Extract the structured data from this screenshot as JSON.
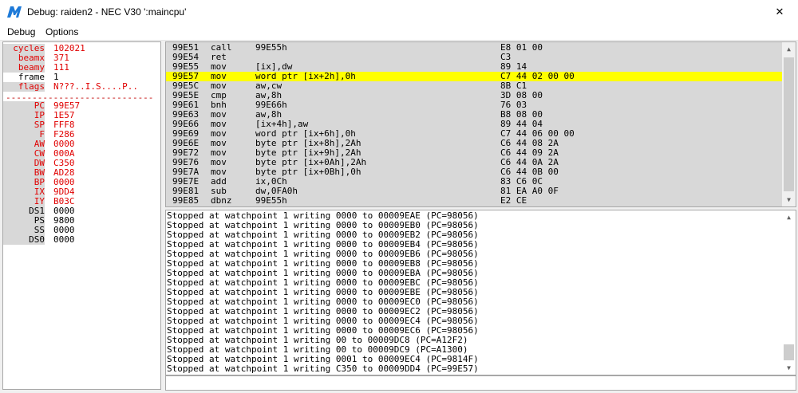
{
  "window": {
    "title": "Debug: raiden2 - NEC V30 ':maincpu'",
    "close_glyph": "✕"
  },
  "menu": [
    "Debug",
    "Options"
  ],
  "registers": {
    "header": [
      {
        "label": "cycles",
        "value": "102021"
      },
      {
        "label": "beamx",
        "value": "371"
      },
      {
        "label": "beamy",
        "value": "111"
      },
      {
        "label": "frame",
        "value": "1"
      },
      {
        "label": "flags",
        "value": "N???..I.S....P.."
      }
    ],
    "separator": "----------------------------",
    "list": [
      {
        "label": "PC",
        "value": "99E57"
      },
      {
        "label": "IP",
        "value": "1E57"
      },
      {
        "label": "SP",
        "value": "FFF8"
      },
      {
        "label": "F",
        "value": "F286"
      },
      {
        "label": "AW",
        "value": "0000"
      },
      {
        "label": "CW",
        "value": "000A"
      },
      {
        "label": "DW",
        "value": "C350"
      },
      {
        "label": "BW",
        "value": "AD28"
      },
      {
        "label": "BP",
        "value": "0000"
      },
      {
        "label": "IX",
        "value": "9DD4"
      },
      {
        "label": "IY",
        "value": "B03C"
      },
      {
        "label": "DS1",
        "value": "0000"
      },
      {
        "label": "PS",
        "value": "9800"
      },
      {
        "label": "SS",
        "value": "0000"
      },
      {
        "label": "DS0",
        "value": "0000"
      }
    ]
  },
  "disassembly": {
    "highlighted_index": 3,
    "rows": [
      {
        "addr": "99E51",
        "mnemonic": "call",
        "operands": "99E55h",
        "bytes": "E8 01 00"
      },
      {
        "addr": "99E54",
        "mnemonic": "ret",
        "operands": "",
        "bytes": "C3"
      },
      {
        "addr": "99E55",
        "mnemonic": "mov",
        "operands": "[ix],dw",
        "bytes": "89 14"
      },
      {
        "addr": "99E57",
        "mnemonic": "mov",
        "operands": "word ptr [ix+2h],0h",
        "bytes": "C7 44 02 00 00"
      },
      {
        "addr": "99E5C",
        "mnemonic": "mov",
        "operands": "aw,cw",
        "bytes": "8B C1"
      },
      {
        "addr": "99E5E",
        "mnemonic": "cmp",
        "operands": "aw,8h",
        "bytes": "3D 08 00"
      },
      {
        "addr": "99E61",
        "mnemonic": "bnh",
        "operands": "99E66h",
        "bytes": "76 03"
      },
      {
        "addr": "99E63",
        "mnemonic": "mov",
        "operands": "aw,8h",
        "bytes": "B8 08 00"
      },
      {
        "addr": "99E66",
        "mnemonic": "mov",
        "operands": "[ix+4h],aw",
        "bytes": "89 44 04"
      },
      {
        "addr": "99E69",
        "mnemonic": "mov",
        "operands": "word ptr [ix+6h],0h",
        "bytes": "C7 44 06 00 00"
      },
      {
        "addr": "99E6E",
        "mnemonic": "mov",
        "operands": "byte ptr [ix+8h],2Ah",
        "bytes": "C6 44 08 2A"
      },
      {
        "addr": "99E72",
        "mnemonic": "mov",
        "operands": "byte ptr [ix+9h],2Ah",
        "bytes": "C6 44 09 2A"
      },
      {
        "addr": "99E76",
        "mnemonic": "mov",
        "operands": "byte ptr [ix+0Ah],2Ah",
        "bytes": "C6 44 0A 2A"
      },
      {
        "addr": "99E7A",
        "mnemonic": "mov",
        "operands": "byte ptr [ix+0Bh],0h",
        "bytes": "C6 44 0B 00"
      },
      {
        "addr": "99E7E",
        "mnemonic": "add",
        "operands": "ix,0Ch",
        "bytes": "83 C6 0C"
      },
      {
        "addr": "99E81",
        "mnemonic": "sub",
        "operands": "dw,0FA0h",
        "bytes": "81 EA A0 0F"
      },
      {
        "addr": "99E85",
        "mnemonic": "dbnz",
        "operands": "99E55h",
        "bytes": "E2 CE"
      }
    ]
  },
  "console": {
    "lines": [
      "Stopped at watchpoint 1 writing 0000 to 00009EAE (PC=98056)",
      "Stopped at watchpoint 1 writing 0000 to 00009EB0 (PC=98056)",
      "Stopped at watchpoint 1 writing 0000 to 00009EB2 (PC=98056)",
      "Stopped at watchpoint 1 writing 0000 to 00009EB4 (PC=98056)",
      "Stopped at watchpoint 1 writing 0000 to 00009EB6 (PC=98056)",
      "Stopped at watchpoint 1 writing 0000 to 00009EB8 (PC=98056)",
      "Stopped at watchpoint 1 writing 0000 to 00009EBA (PC=98056)",
      "Stopped at watchpoint 1 writing 0000 to 00009EBC (PC=98056)",
      "Stopped at watchpoint 1 writing 0000 to 00009EBE (PC=98056)",
      "Stopped at watchpoint 1 writing 0000 to 00009EC0 (PC=98056)",
      "Stopped at watchpoint 1 writing 0000 to 00009EC2 (PC=98056)",
      "Stopped at watchpoint 1 writing 0000 to 00009EC4 (PC=98056)",
      "Stopped at watchpoint 1 writing 0000 to 00009EC6 (PC=98056)",
      "Stopped at watchpoint 1 writing 00 to 00009DC8 (PC=A12F2)",
      "Stopped at watchpoint 1 writing 00 to 00009DC9 (PC=A1300)",
      "Stopped at watchpoint 1 writing 0001 to 00009EC4 (PC=9814F)",
      "Stopped at watchpoint 1 writing C350 to 00009DD4 (PC=99E57)"
    ]
  },
  "command": {
    "value": ""
  },
  "colors": {
    "highlight": "#ffff00",
    "register_label": "#e00000",
    "register_value": "#e00000",
    "panel_gray": "#d8d8d8",
    "icon_blue": "#1e7ad8"
  },
  "icons": {
    "app": "mame-logo-icon",
    "close": "close-icon",
    "scroll_up": "scroll-up-arrow-icon",
    "scroll_down": "scroll-down-arrow-icon"
  }
}
